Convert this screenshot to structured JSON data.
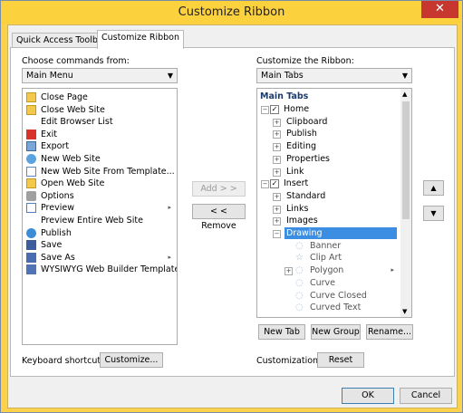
{
  "window": {
    "title": "Customize Ribbon",
    "close_symbol": "✕"
  },
  "tabs": [
    {
      "label": "Quick Access Toolbar"
    },
    {
      "label": "Customize Ribbon"
    }
  ],
  "left": {
    "label": "Choose commands from:",
    "combo_value": "Main Menu",
    "items": [
      {
        "label": "Close Page",
        "icon": "folder-icon"
      },
      {
        "label": "Close Web Site",
        "icon": "folder-icon"
      },
      {
        "label": "Edit Browser List",
        "icon": ""
      },
      {
        "label": "Exit",
        "icon": "exit-icon"
      },
      {
        "label": "Export",
        "icon": "export-icon"
      },
      {
        "label": "New Web Site",
        "icon": "new-site-icon"
      },
      {
        "label": "New Web Site From Template...",
        "icon": "template-icon"
      },
      {
        "label": "Open Web Site",
        "icon": "folder-icon"
      },
      {
        "label": "Options",
        "icon": "options-icon"
      },
      {
        "label": "Preview",
        "icon": "preview-icon",
        "submenu": true
      },
      {
        "label": "Preview Entire Web Site",
        "icon": ""
      },
      {
        "label": "Publish",
        "icon": "publish-icon"
      },
      {
        "label": "Save",
        "icon": "save-icon"
      },
      {
        "label": "Save As",
        "icon": "save-as-icon",
        "submenu": true
      },
      {
        "label": "WYSIWYG Web Builder Template",
        "icon": "save-template-icon"
      }
    ]
  },
  "middle": {
    "add_label": "Add > >",
    "remove_label": "< < Remove"
  },
  "right": {
    "label": "Customize the Ribbon:",
    "combo_value": "Main Tabs",
    "header": "Main Tabs",
    "tree": [
      {
        "label": "Home",
        "level": 0,
        "expander": "−",
        "checkbox": true
      },
      {
        "label": "Clipboard",
        "level": 1,
        "expander": "+"
      },
      {
        "label": "Publish",
        "level": 1,
        "expander": "+"
      },
      {
        "label": "Editing",
        "level": 1,
        "expander": "+"
      },
      {
        "label": "Properties",
        "level": 1,
        "expander": "+"
      },
      {
        "label": "Link",
        "level": 1,
        "expander": "+"
      },
      {
        "label": "Insert",
        "level": 0,
        "expander": "−",
        "checkbox": true
      },
      {
        "label": "Standard",
        "level": 1,
        "expander": "+"
      },
      {
        "label": "Links",
        "level": 1,
        "expander": "+"
      },
      {
        "label": "Images",
        "level": 1,
        "expander": "+"
      },
      {
        "label": "Drawing",
        "level": 1,
        "expander": "−",
        "selected": true
      },
      {
        "label": "Banner",
        "level": 2,
        "shape": "banner-icon"
      },
      {
        "label": "Clip Art",
        "level": 2,
        "shape": "clipart-icon"
      },
      {
        "label": "Polygon",
        "level": 2,
        "expander": "+",
        "shape": "polygon-icon",
        "submenu": true
      },
      {
        "label": "Curve",
        "level": 2,
        "shape": "curve-icon"
      },
      {
        "label": "Curve Closed",
        "level": 2,
        "shape": "curve-closed-icon"
      },
      {
        "label": "Curved Text",
        "level": 2,
        "shape": "curved-text-icon"
      }
    ],
    "new_tab": "New Tab",
    "new_group": "New Group",
    "rename": "Rename...",
    "customizations_label": "Customizations:",
    "reset": "Reset"
  },
  "keyboard": {
    "label": "Keyboard shortcuts:",
    "customize": "Customize..."
  },
  "footer": {
    "ok": "OK",
    "cancel": "Cancel"
  }
}
